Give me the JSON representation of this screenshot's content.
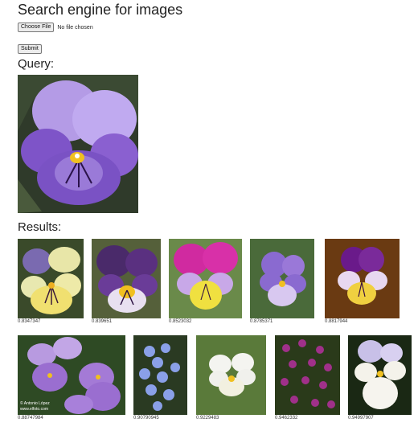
{
  "page": {
    "title": "Search engine for images",
    "choose_file_label": "Choose File",
    "no_file_label": "No file chosen",
    "submit_label": "Submit",
    "query_heading": "Query:",
    "results_heading": "Results:"
  },
  "results": [
    {
      "score": "0.8347347"
    },
    {
      "score": "0.839651"
    },
    {
      "score": "0.8523032"
    },
    {
      "score": "0.8785371"
    },
    {
      "score": "0.8817944"
    },
    {
      "score": "0.88747984"
    },
    {
      "score": "0.90790945"
    },
    {
      "score": "0.9229483"
    },
    {
      "score": "0.9462332"
    },
    {
      "score": "0.94997907"
    }
  ],
  "watermark": "© Antonio López\nwww.elfoto.com"
}
